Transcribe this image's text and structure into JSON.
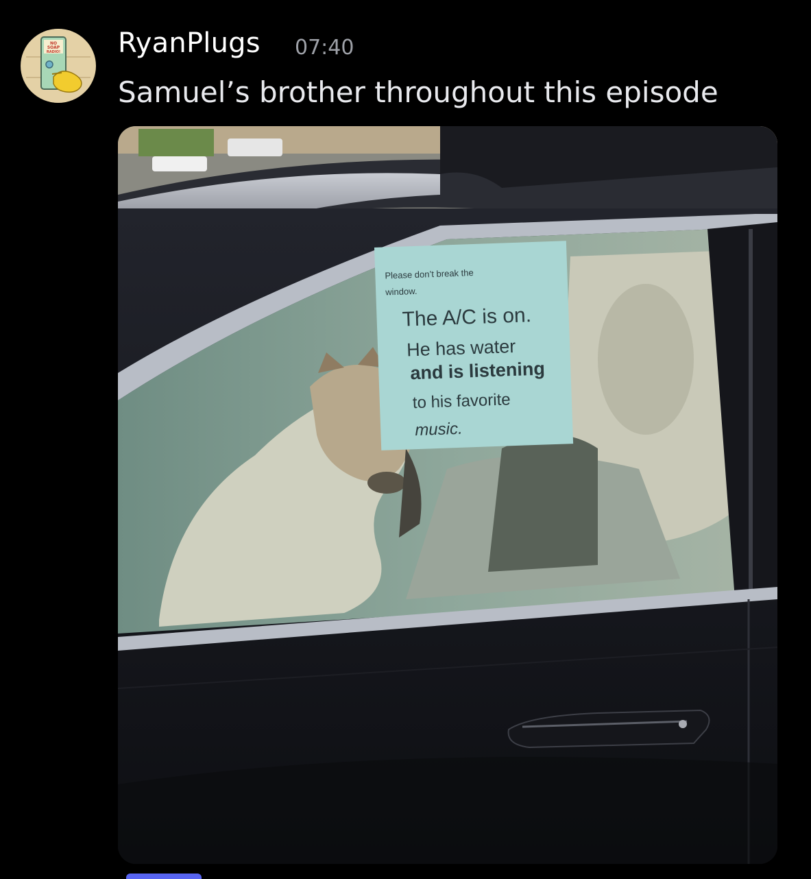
{
  "message": {
    "author": "RyanPlugs",
    "timestamp": "07:40",
    "content": "Samuel’s brother throughout this episode",
    "avatar": {
      "icon": "simpsons-no-soap-radio-avatar-icon",
      "lettering": "NO SOAP RADIO!"
    }
  },
  "attachment": {
    "icon": "image-attachment",
    "sign_lines": [
      "Please don’t break the",
      "window.",
      "The A/C is on.",
      "He has water",
      "and is listening",
      "to his favorite",
      "music."
    ]
  },
  "colors": {
    "background": "#000000",
    "author": "#ffffff",
    "timestamp": "#9ea1a8",
    "text": "#e9eaee",
    "accent": "#5865f2"
  }
}
